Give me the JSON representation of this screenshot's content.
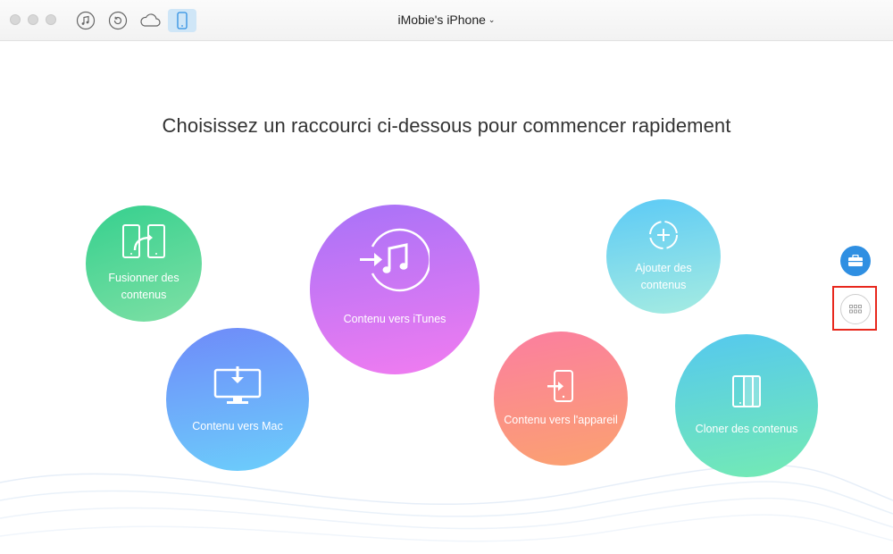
{
  "titlebar": {
    "device_name": "iMobie's iPhone",
    "caret": "⌄",
    "icons": [
      "music-icon",
      "backup-icon",
      "cloud-icon",
      "device-icon"
    ]
  },
  "main": {
    "heading": "Choisissez un raccourci ci-dessous pour commencer rapidement",
    "shortcuts": {
      "merge": {
        "line1": "Fusionner des",
        "line2": "contenus"
      },
      "mac": {
        "label": "Contenu vers Mac"
      },
      "itunes": {
        "label": "Contenu vers iTunes"
      },
      "add": {
        "line1": "Ajouter des",
        "line2": "contenus"
      },
      "device": {
        "label": "Contenu vers l'appareil"
      },
      "clone": {
        "label": "Cloner des contenus"
      }
    }
  },
  "colors": {
    "accent": "#2f8fe2",
    "highlight": "#e8281d"
  }
}
